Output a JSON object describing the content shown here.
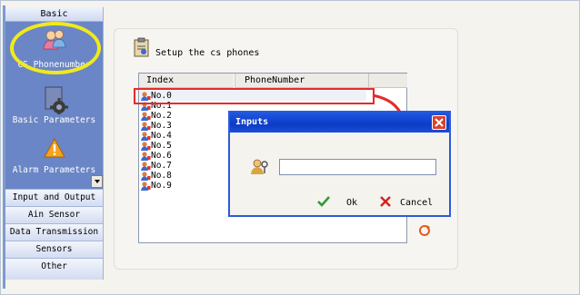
{
  "sidebar": {
    "header": "Basic",
    "panel_items": [
      "CS Phonenumber",
      "Basic Parameters",
      "Alarm Parameters"
    ],
    "items": [
      "Input and Output",
      "Ain Sensor",
      "Data Transmission",
      "Sensors",
      "Other"
    ]
  },
  "main": {
    "title": "Setup the cs phones",
    "columns": [
      "Index",
      "PhoneNumber"
    ],
    "rows": [
      "No.0",
      "No.1",
      "No.2",
      "No.3",
      "No.4",
      "No.5",
      "No.6",
      "No.7",
      "No.8",
      "No.9"
    ]
  },
  "dialog": {
    "title": "Inputs",
    "input_value": "",
    "ok_label": "Ok",
    "cancel_label": "Cancel"
  },
  "colors": {
    "accent": "#0d3bc6",
    "highlight_ring": "#f0ea1a",
    "annotation_red": "#e52b2b"
  }
}
